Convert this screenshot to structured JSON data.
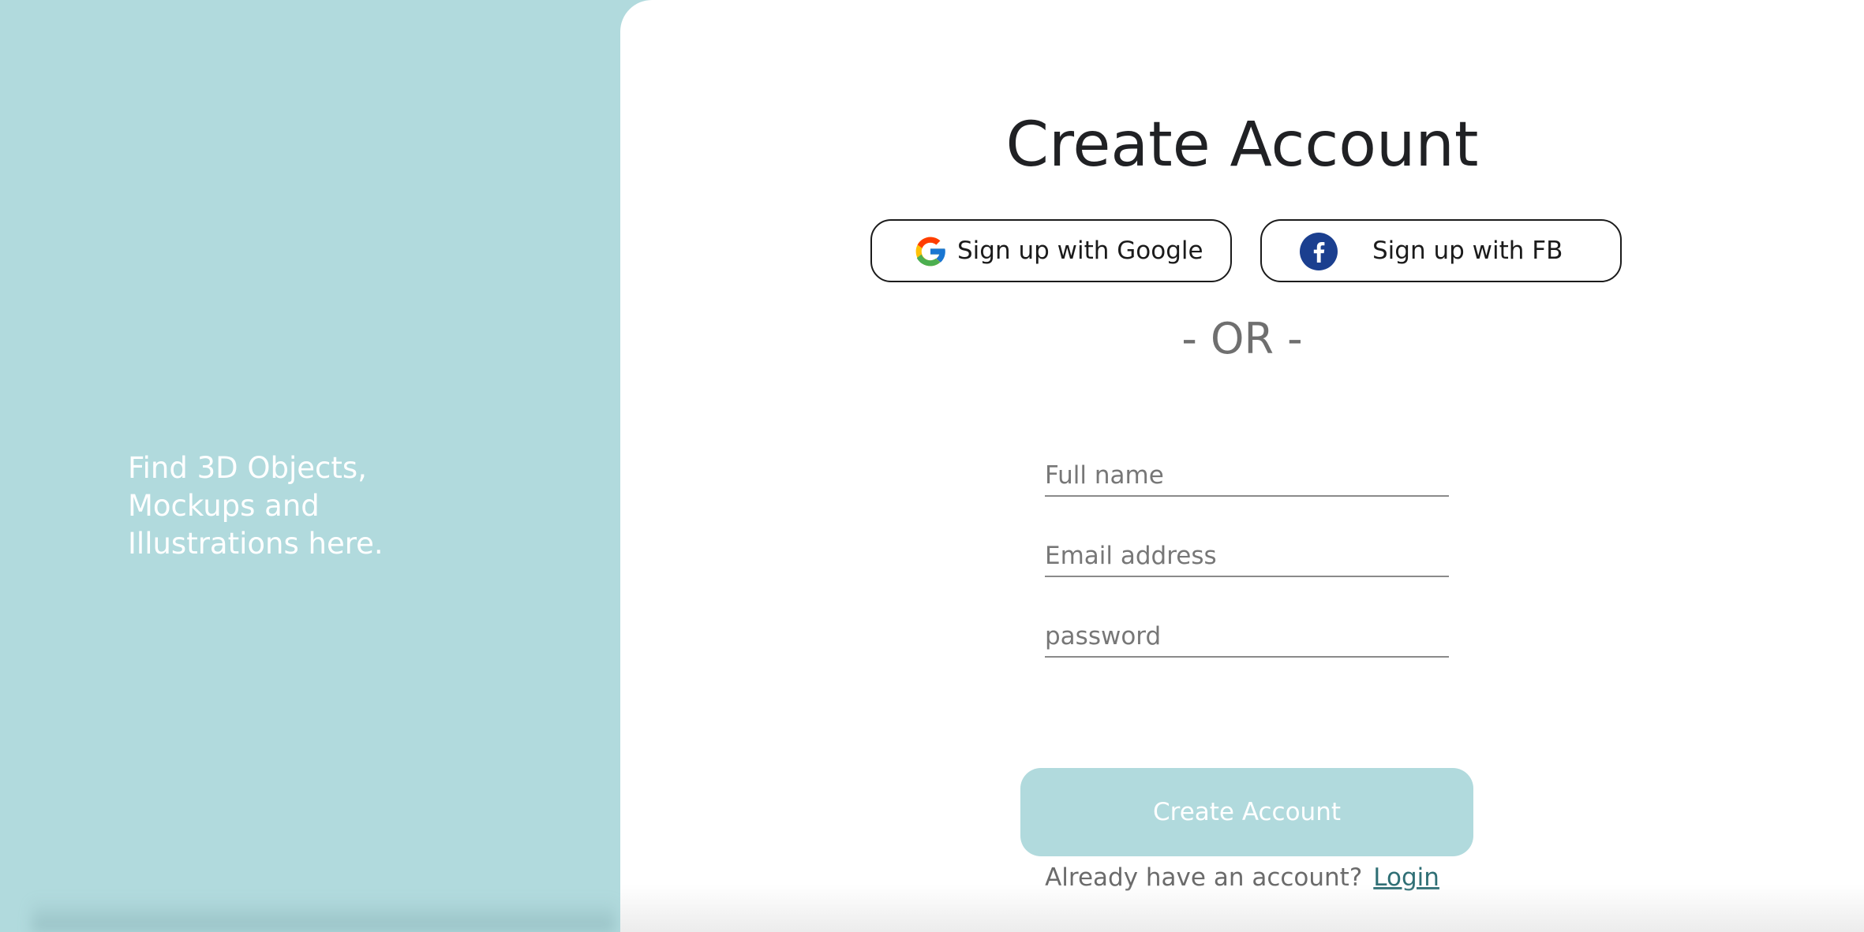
{
  "left_panel": {
    "tagline": "Find 3D Objects,\nMockups and\nIllustrations here."
  },
  "form": {
    "title": "Create Account",
    "google_button_label": "Sign up with Google",
    "facebook_button_label": "Sign up with FB",
    "divider_text": "- OR -",
    "fields": {
      "full_name": {
        "placeholder": "Full name",
        "value": ""
      },
      "email": {
        "placeholder": "Email address",
        "value": ""
      },
      "password": {
        "placeholder": "password",
        "value": ""
      }
    },
    "submit_label": "Create Account",
    "login_prompt": "Already have an account?",
    "login_link": "Login"
  },
  "icons": {
    "google": "google-logo-icon",
    "facebook": "facebook-logo-icon"
  },
  "colors": {
    "accent": "#b1dadd",
    "facebook_blue": "#1b3f8f",
    "login_link": "#2f6f75",
    "title_text": "#202124"
  }
}
